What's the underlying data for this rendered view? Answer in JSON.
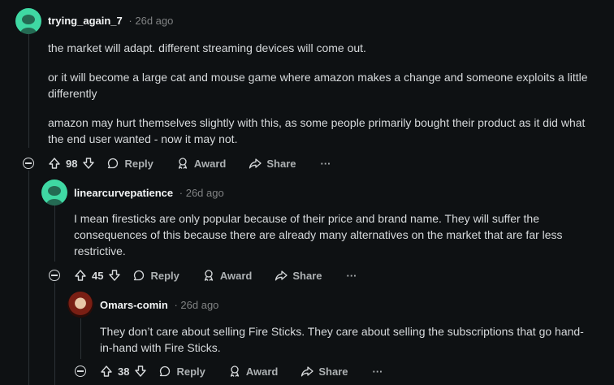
{
  "comments": [
    {
      "username": "trying_again_7",
      "time": "26d ago",
      "paragraphs": [
        "the market will adapt. different streaming devices will come out.",
        "or it will become a large cat and mouse game where amazon makes a change and someone exploits a little differently",
        "amazon may hurt themselves slightly with this, as some people primarily bought their product as it did what the end user wanted - now it may not."
      ],
      "votes": "98",
      "reply_label": "Reply",
      "award_label": "Award",
      "share_label": "Share",
      "more_label": "···"
    },
    {
      "username": "linearcurvepatience",
      "time": "26d ago",
      "paragraphs": [
        "I mean firesticks are only popular because of their price and brand name. They will suffer the consequences of this because there are already many alternatives on the market that are far less restrictive."
      ],
      "votes": "45",
      "reply_label": "Reply",
      "award_label": "Award",
      "share_label": "Share",
      "more_label": "···"
    },
    {
      "username": "Omars-comin",
      "time": "26d ago",
      "paragraphs": [
        "They don’t care about selling Fire Sticks. They care about selling the subscriptions that go hand-in-hand with Fire Sticks."
      ],
      "votes": "38",
      "reply_label": "Reply",
      "award_label": "Award",
      "share_label": "Share",
      "more_label": "···"
    }
  ],
  "separator": "·",
  "colors": {
    "background": "#0e1113",
    "text": "#d7dadc",
    "muted": "#818384",
    "snoo_avatar": "#3fd8a3"
  }
}
